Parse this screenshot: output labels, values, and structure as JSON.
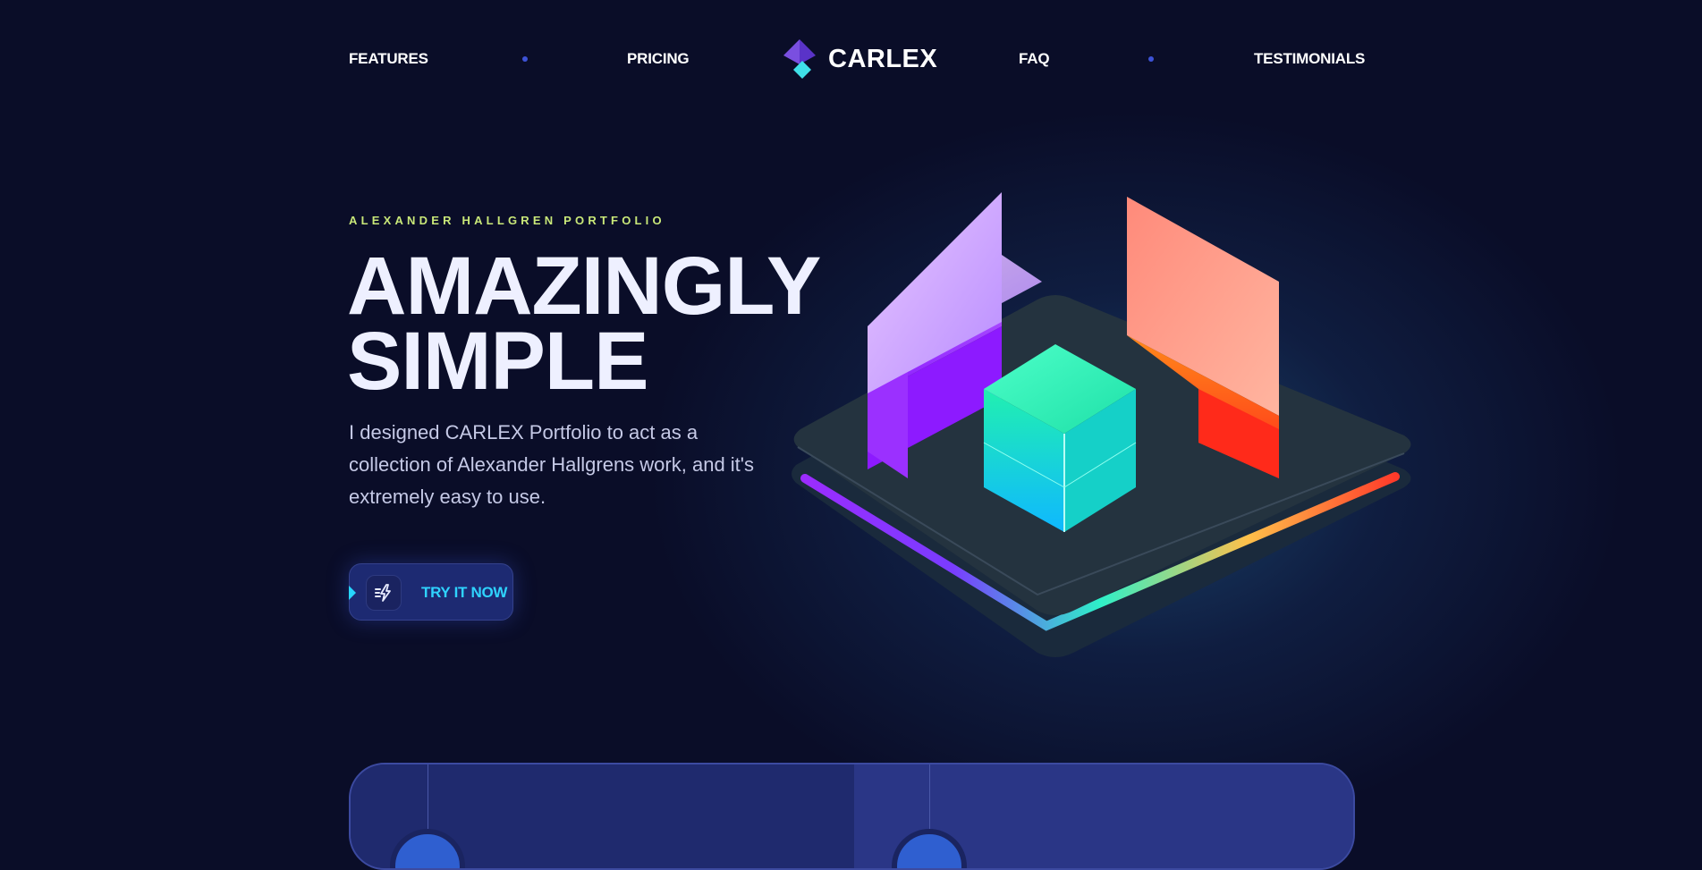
{
  "nav": {
    "left_links": [
      "FEATURES",
      "PRICING"
    ],
    "right_links": [
      "FAQ",
      "TESTIMONIALS"
    ],
    "logo_text": "CARLEX"
  },
  "hero": {
    "eyebrow": "ALEXANDER HALLGREN PORTFOLIO",
    "headline_line1": "AMAZINGLY",
    "headline_line2": "SIMPLE",
    "subtitle": "I designed CARLEX Portfolio to act as a collection of Alexander Hallgrens work, and it's extremely easy to use.",
    "cta_label": "TRY IT NOW"
  },
  "colors": {
    "background": "#0a0d28",
    "accent_eyebrow": "#c9e879",
    "accent_cta": "#2fd3ff",
    "nav_dot": "#3d52d6"
  },
  "icons": {
    "logo": "carlex-diamond-logo-icon",
    "cta": "speed-lightning-icon"
  }
}
